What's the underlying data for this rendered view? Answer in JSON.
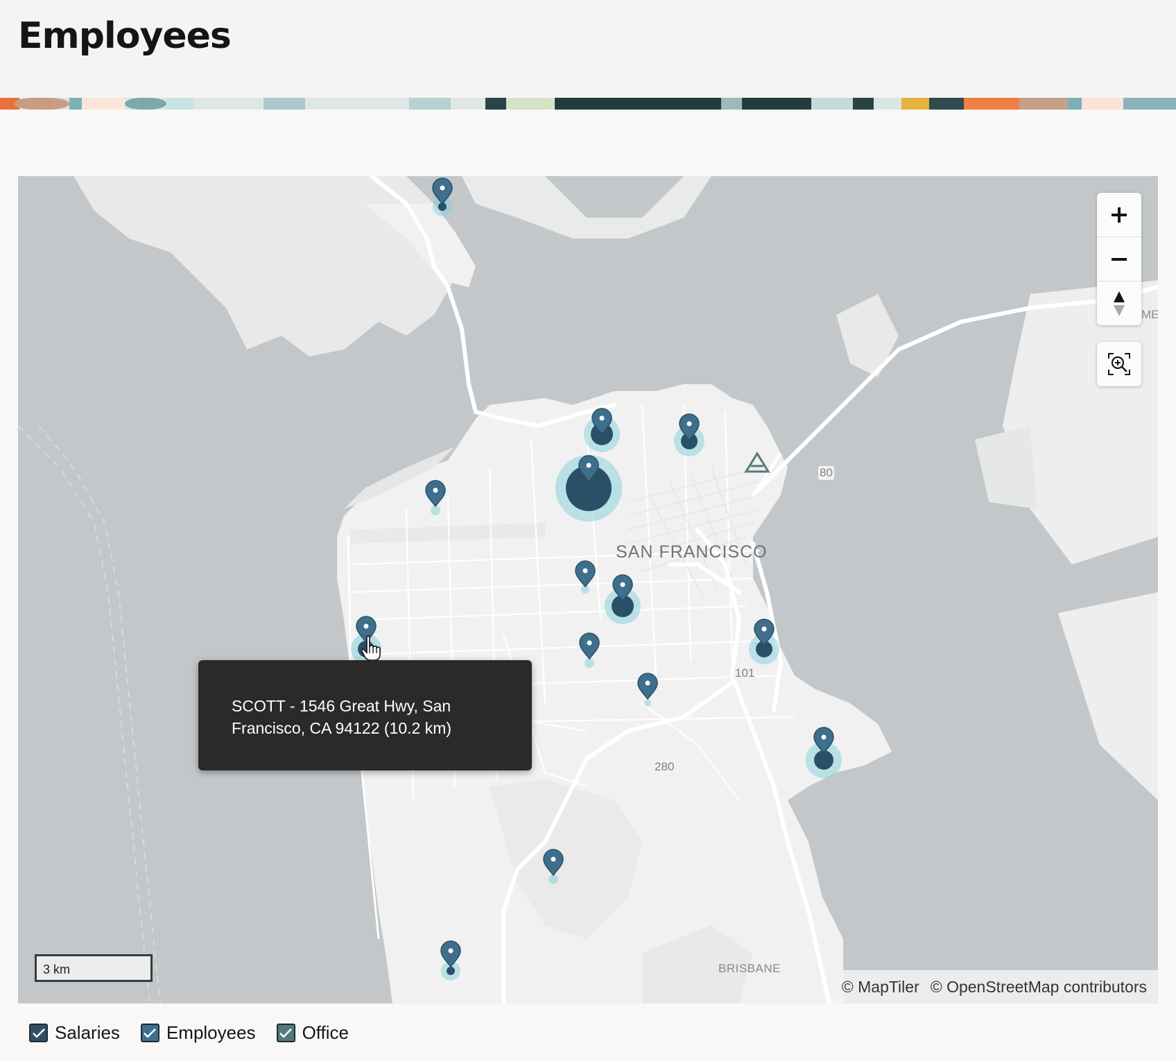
{
  "page": {
    "title": "Employees"
  },
  "colors": {
    "marker_fill": "#3f6f8c",
    "marker_dark": "#2a5068",
    "halo": "#7fd0d9",
    "water": "#c3c7ca",
    "land": "#f1f1f1",
    "roads": "#ffffff",
    "tooltip_bg": "#2b2a28",
    "checkbox_salaries": "#2f4f66",
    "checkbox_employees": "#3f6f8c",
    "checkbox_office": "#537a7a"
  },
  "map": {
    "city_label": "SAN FRANCISCO",
    "highway_labels": [
      "80",
      "101",
      "280"
    ],
    "town_label": "BRISBANE",
    "edge_label": "MEF",
    "tooltip": {
      "line1": "SCOTT - 1546 Great Hwy, San",
      "line2": "Francisco, CA 94122 (10.2 km)"
    },
    "scale_label": "3 km",
    "attribution": {
      "maptiler": "© MapTiler",
      "osm": "© OpenStreetMap contributors"
    },
    "controls": {
      "zoom_in": "zoom-in",
      "zoom_out": "zoom-out",
      "compass": "compass",
      "zoom_to_fit": "zoom-to-fit"
    }
  },
  "legend": {
    "items": [
      {
        "label": "Salaries",
        "checked": true
      },
      {
        "label": "Employees",
        "checked": true
      },
      {
        "label": "Office",
        "checked": true
      }
    ]
  }
}
